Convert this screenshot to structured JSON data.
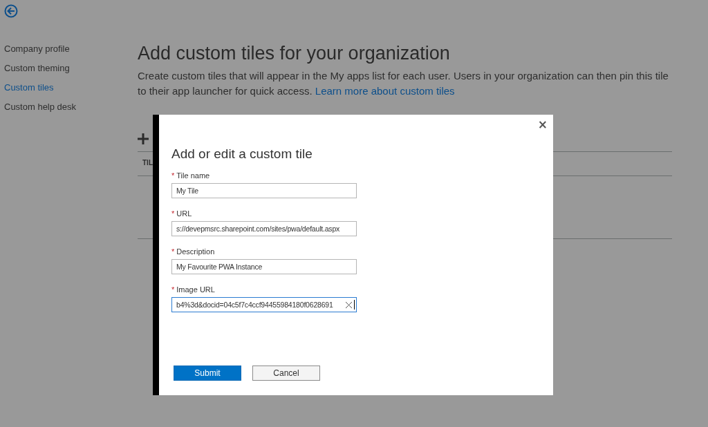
{
  "sidebar": {
    "items": [
      {
        "label": "Company profile",
        "selected": false
      },
      {
        "label": "Custom theming",
        "selected": false
      },
      {
        "label": "Custom tiles",
        "selected": true
      },
      {
        "label": "Custom help desk",
        "selected": false
      }
    ]
  },
  "main": {
    "title": "Add custom tiles for your organization",
    "description": "Create custom tiles that will appear in the My apps list for each user. Users in your organization can then pin this tile to their app launcher for quick access.",
    "link": "Learn more about custom tiles",
    "table": {
      "columns": [
        "TIL"
      ]
    }
  },
  "dialog": {
    "title": "Add or edit a custom tile",
    "close": "×",
    "fields": [
      {
        "marker": "*",
        "label": "Tile name",
        "value": "My Tile",
        "focused": false
      },
      {
        "marker": "*",
        "label": "URL",
        "value": "s://devepmsrc.sharepoint.com/sites/pwa/default.aspx",
        "focused": false
      },
      {
        "marker": "*",
        "label": "Description",
        "value": "My Favourite PWA Instance",
        "focused": false
      },
      {
        "marker": "*",
        "label": "Image URL",
        "value": "b4%3d&docid=04c5f7c4ccf94455984180f0628691",
        "focused": true
      }
    ],
    "buttons": [
      {
        "label": "Submit",
        "kind": "primary"
      },
      {
        "label": "Cancel",
        "kind": "secondary"
      }
    ]
  }
}
